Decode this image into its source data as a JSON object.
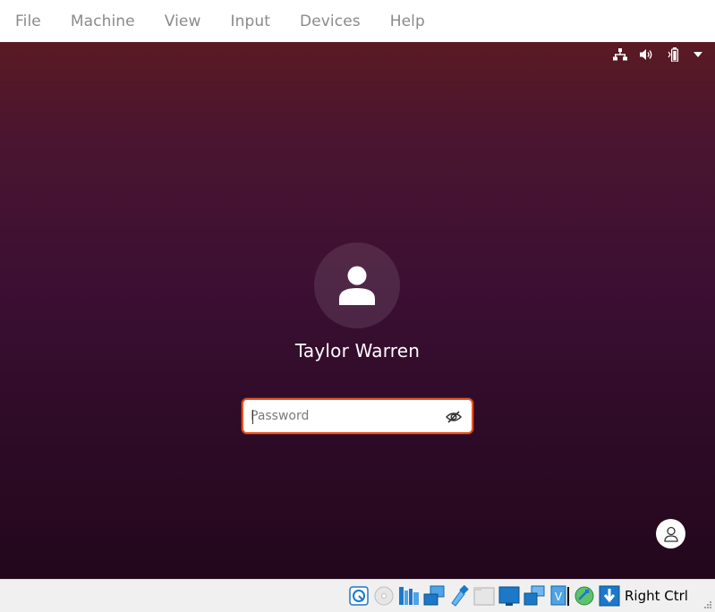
{
  "menubar": {
    "items": [
      "File",
      "Machine",
      "View",
      "Input",
      "Devices",
      "Help"
    ]
  },
  "guest": {
    "topbar_icons": [
      "network-icon",
      "volume-icon",
      "battery-icon",
      "system-menu-arrow-icon"
    ],
    "user_name": "Taylor Warren",
    "password_placeholder": "Password",
    "colors": {
      "accent": "#e95420",
      "background_top": "#5a1a23",
      "background_bottom": "#22071c"
    }
  },
  "statusbar": {
    "icons": [
      "hard-disk-icon",
      "optical-drive-icon",
      "audio-icon",
      "network-adapters-icon",
      "usb-icon",
      "shared-folders-icon",
      "display-icon",
      "recording-icon",
      "virtualization-icon",
      "mouse-integration-icon",
      "keyboard-capture-icon"
    ],
    "host_key_label": "Right Ctrl"
  }
}
